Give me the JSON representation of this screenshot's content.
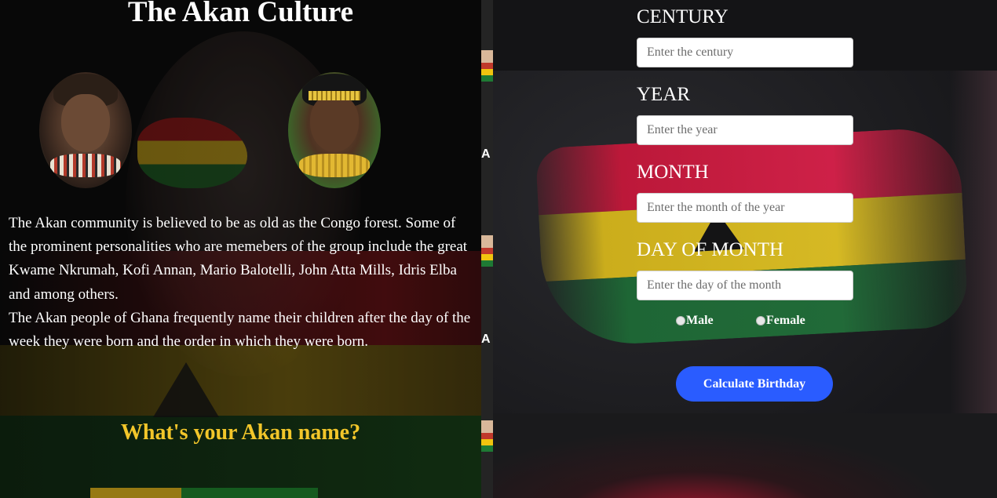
{
  "header": {
    "title": "The Akan Culture"
  },
  "intro": {
    "paragraphs": [
      "The Akan community is believed to be as old as the Congo forest. Some of the prominent personalities who are memebers of the group include the great Kwame Nkrumah, Kofi Annan, Mario Balotelli, John Atta Mills, Idris Elba and among others.",
      "The Akan people of Ghana frequently name their children after the day of the week they were born and the order in which they were born."
    ],
    "cta": "What's your Akan name?"
  },
  "gap_strip": {
    "letter": "A"
  },
  "form": {
    "century": {
      "label": "CENTURY",
      "placeholder": "Enter the century"
    },
    "year": {
      "label": "YEAR",
      "placeholder": "Enter the year"
    },
    "month": {
      "label": "MONTH",
      "placeholder": "Enter the month of the year"
    },
    "day": {
      "label": "DAY OF MONTH",
      "placeholder": "Enter the day of the month"
    },
    "gender": {
      "male": "Male",
      "female": "Female"
    },
    "submit_label": "Calculate Birthday"
  },
  "colors": {
    "title": "#ffffff",
    "cta": "#f2c62a",
    "button": "#2a5cff",
    "flag_red": "#c4183a",
    "flag_yellow": "#d4b51c",
    "flag_green": "#1e6a36"
  }
}
